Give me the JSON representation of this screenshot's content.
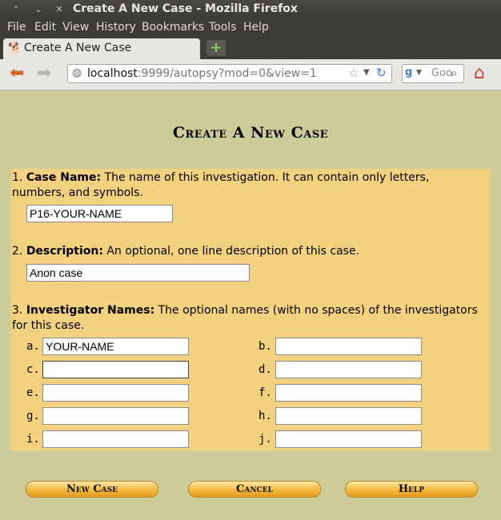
{
  "window": {
    "title": "Create A New Case - Mozilla Firefox"
  },
  "menubar": {
    "items": [
      "File",
      "Edit",
      "View",
      "History",
      "Bookmarks",
      "Tools",
      "Help"
    ]
  },
  "tab": {
    "label": "Create A New Case"
  },
  "nav": {
    "url_host": "localhost",
    "url_rest": ":9999/autopsy?mod=0&view=1",
    "search_placeholder": "Goo"
  },
  "page": {
    "title": "Create A New Case",
    "case_name": {
      "number": "1.",
      "label": "Case Name:",
      "description": " The name of this investigation. It can contain only letters, numbers, and symbols.",
      "value": "P16-YOUR-NAME"
    },
    "description": {
      "number": "2.",
      "label": "Description:",
      "description": " An optional, one line description of this case.",
      "value": "Anon case"
    },
    "investigators": {
      "number": "3.",
      "label": "Investigator Names:",
      "description": " The optional names (with no spaces) of the investigators for this case.",
      "fields": [
        {
          "label": "a.",
          "value": "YOUR-NAME"
        },
        {
          "label": "b.",
          "value": ""
        },
        {
          "label": "c.",
          "value": ""
        },
        {
          "label": "d.",
          "value": ""
        },
        {
          "label": "e.",
          "value": ""
        },
        {
          "label": "f.",
          "value": ""
        },
        {
          "label": "g.",
          "value": ""
        },
        {
          "label": "h.",
          "value": ""
        },
        {
          "label": "i.",
          "value": ""
        },
        {
          "label": "j.",
          "value": ""
        }
      ]
    },
    "buttons": {
      "new_case": "New Case",
      "cancel": "Cancel",
      "help": "Help"
    }
  }
}
